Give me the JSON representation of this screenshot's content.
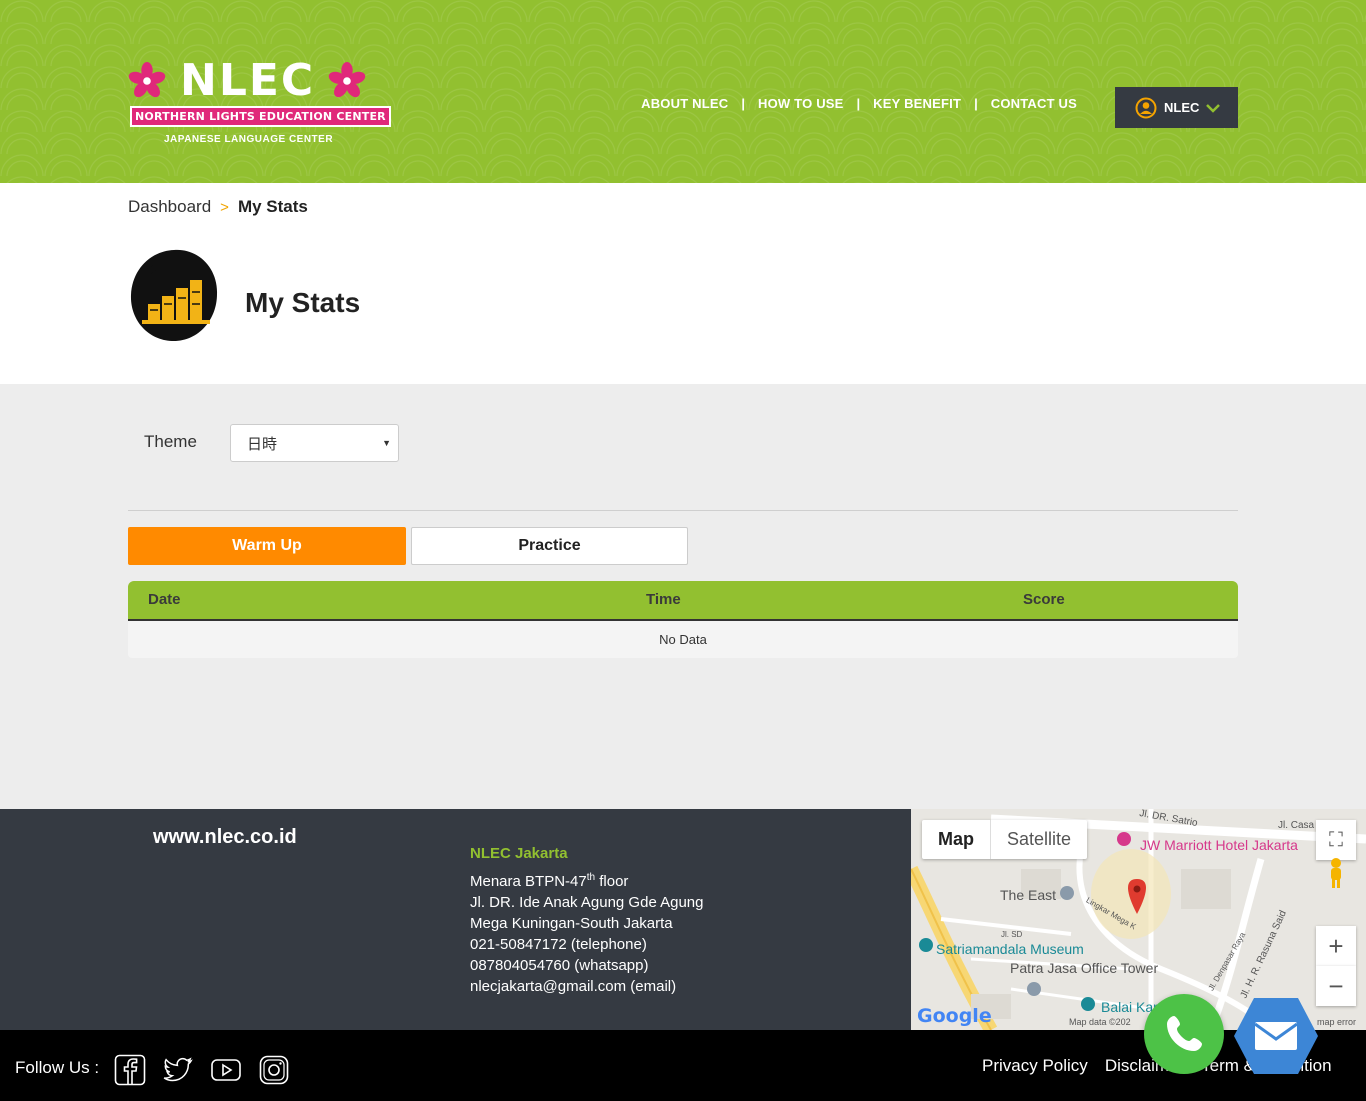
{
  "header": {
    "logo": {
      "title": "NLEC",
      "subtitle": "NORTHERN LIGHTS EDUCATION CENTER",
      "tagline": "JAPANESE LANGUAGE CENTER"
    },
    "nav": [
      "ABOUT NLEC",
      "HOW TO USE",
      "KEY BENEFIT",
      "CONTACT US"
    ],
    "user": {
      "name": "NLEC",
      "icon": "user-circle-icon"
    },
    "colors": {
      "brand_green": "#92c030",
      "accent_orange": "#ff8a00",
      "dark": "#353a42"
    }
  },
  "breadcrumb": {
    "root": "Dashboard",
    "separator": ">",
    "current": "My Stats"
  },
  "page": {
    "title": "My Stats",
    "icon": "bar-chart-brush-icon"
  },
  "filters": {
    "theme_label": "Theme",
    "theme_value": "日時"
  },
  "tabs": {
    "warmup": "Warm Up",
    "practice": "Practice",
    "active": "Warm Up"
  },
  "table": {
    "columns": [
      "Date",
      "Time",
      "Score"
    ],
    "empty_text": "No Data"
  },
  "footer": {
    "site_url": "www.nlec.co.id",
    "office": {
      "name": "NLEC Jakarta",
      "line1_prefix": "Menara BTPN-47",
      "line1_sup": "th",
      "line1_suffix": " floor",
      "line2": "Jl. DR. Ide Anak Agung Gde Agung",
      "line3": "Mega Kuningan-South Jakarta",
      "phone": "021-50847172 (telephone)",
      "whatsapp": "087804054760 (whatsapp)",
      "email": "nlecjakarta@gmail.com (email)"
    },
    "map": {
      "tab_map": "Map",
      "tab_satellite": "Satellite",
      "labels": {
        "marriott": "JW Marriott Hotel Jakarta",
        "the_east": "The East",
        "museum": "Satriamandala Museum",
        "patra": "Patra Jasa Office Tower",
        "balai": "Balai Kar",
        "satrio": "Jl. DR. Satrio",
        "casa": "Jl. Casa",
        "mega": "Lingkar Mega K",
        "sd": "Jl. SD",
        "denpasar": "Jl. Denpasar Raya",
        "rasuna": "Jl. H. R. Rasuna Said",
        "data": "Map data ©202",
        "error": "map error",
        "google": "Google"
      }
    }
  },
  "bottom": {
    "follow_label": "Follow Us :",
    "social": [
      "facebook-icon",
      "twitter-icon",
      "youtube-icon",
      "instagram-icon"
    ],
    "links": [
      "Privacy Policy",
      "Disclaimer",
      "Term & Condition"
    ]
  }
}
